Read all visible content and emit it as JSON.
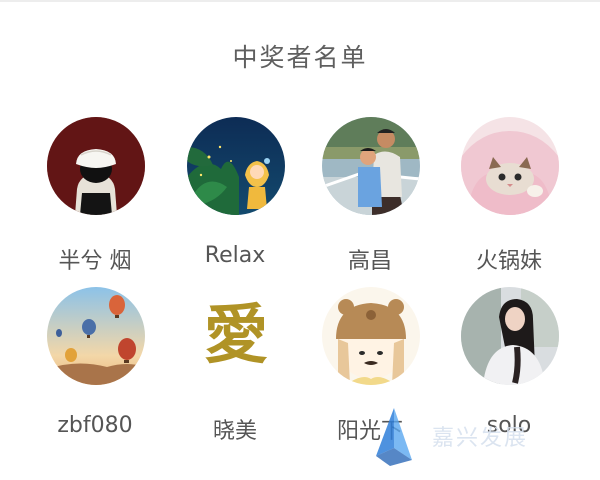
{
  "page": {
    "title": "中奖者名单"
  },
  "winners": [
    {
      "name": "半兮 烟",
      "avatar": "avatar-girl-white-hat"
    },
    {
      "name": "Relax",
      "avatar": "avatar-cartoon-girl-night"
    },
    {
      "name": "高昌",
      "avatar": "avatar-father-child-photo"
    },
    {
      "name": "火锅妹",
      "avatar": "avatar-cat-blanket"
    },
    {
      "name": "zbf080",
      "avatar": "avatar-hot-air-balloons"
    },
    {
      "name": "晓美",
      "avatar": "avatar-gold-love-character"
    },
    {
      "name": "阳光下",
      "avatar": "avatar-girl-bear-hat"
    },
    {
      "name": "solo",
      "avatar": "avatar-girl-long-hair"
    }
  ],
  "watermark": {
    "text": "嘉兴发展",
    "icon": "blue-triangle-logo-icon"
  },
  "colors": {
    "title": "#5f5f5f",
    "name": "#555555",
    "divider": "#ededed"
  }
}
